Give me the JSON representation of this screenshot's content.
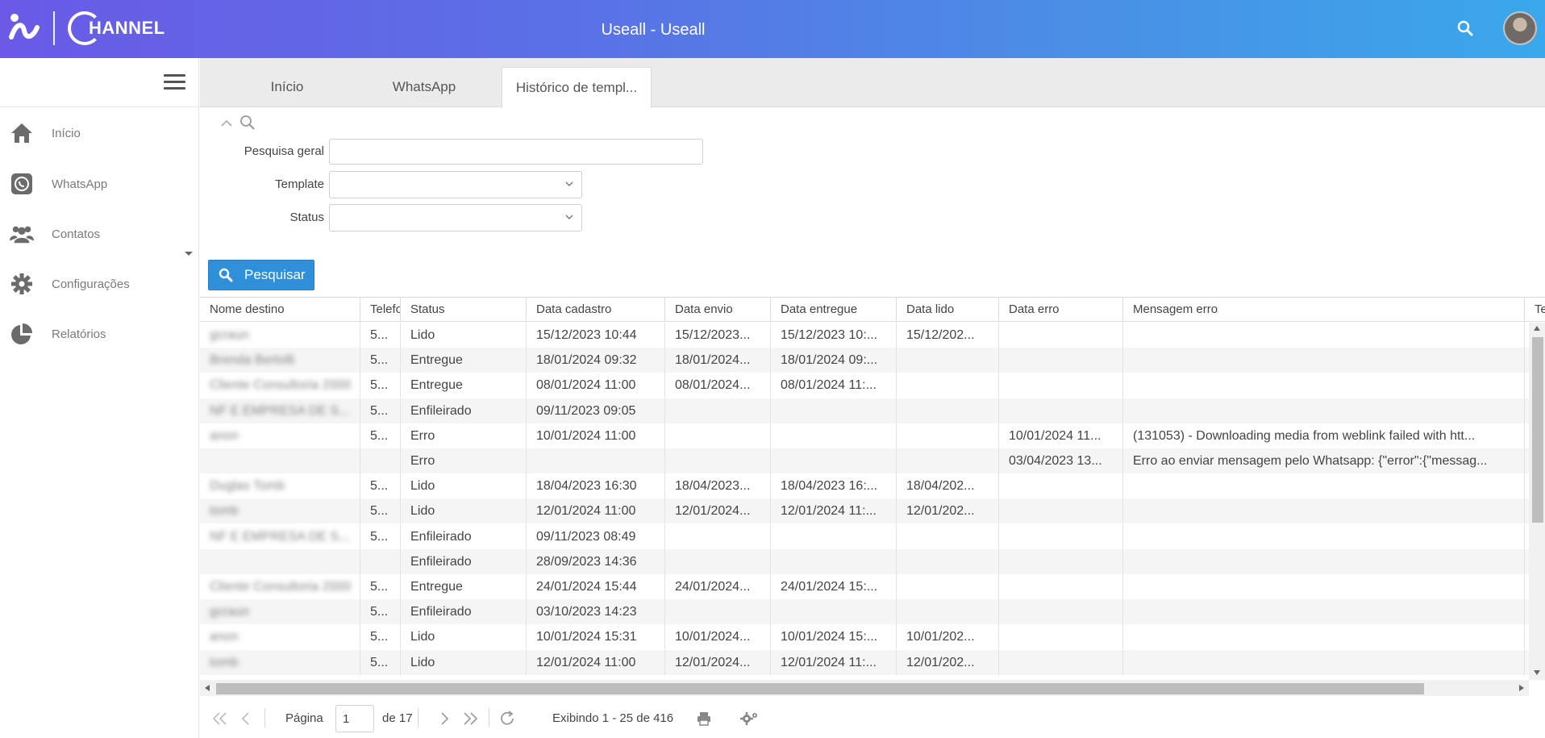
{
  "header": {
    "app_title": "Useall - Useall",
    "logo_text": "HANNEL"
  },
  "sidebar": {
    "items": [
      {
        "label": "Início",
        "icon": "home-icon"
      },
      {
        "label": "WhatsApp",
        "icon": "whatsapp-icon"
      },
      {
        "label": "Contatos",
        "icon": "contacts-icon"
      },
      {
        "label": "Configurações",
        "icon": "gear-icon"
      },
      {
        "label": "Relatórios",
        "icon": "pie-chart-icon"
      }
    ]
  },
  "tabs": [
    {
      "label": "Início",
      "active": false
    },
    {
      "label": "WhatsApp",
      "active": false
    },
    {
      "label": "Histórico de templ...",
      "active": true
    }
  ],
  "filter": {
    "general_search_label": "Pesquisa geral",
    "general_search_value": "",
    "template_label": "Template",
    "template_value": "",
    "status_label": "Status",
    "status_value": "",
    "search_button": "Pesquisar"
  },
  "grid": {
    "columns": [
      "Nome destino",
      "Telefo",
      "Status",
      "Data cadastro",
      "Data envio",
      "Data entregue",
      "Data lido",
      "Data erro",
      "Mensagem erro",
      "Te"
    ],
    "rows": [
      [
        "gcraun",
        "5...",
        "Lido",
        "15/12/2023 10:44",
        "15/12/2023...",
        "15/12/2023 10:...",
        "15/12/202...",
        "",
        ""
      ],
      [
        "Brenda Bertolli",
        "5...",
        "Entregue",
        "18/01/2024 09:32",
        "18/01/2024...",
        "18/01/2024 09:...",
        "",
        "",
        ""
      ],
      [
        "Cliente Consultoria 2000",
        "5...",
        "Entregue",
        "08/01/2024 11:00",
        "08/01/2024...",
        "08/01/2024 11:...",
        "",
        "",
        ""
      ],
      [
        "NF E EMPRESA DE S...",
        "5...",
        "Enfileirado",
        "09/11/2023 09:05",
        "",
        "",
        "",
        "",
        ""
      ],
      [
        "anon",
        "5...",
        "Erro",
        "10/01/2024 11:00",
        "",
        "",
        "",
        "10/01/2024 11...",
        "(131053) - Downloading media from weblink failed with htt..."
      ],
      [
        "",
        "",
        "Erro",
        "",
        "",
        "",
        "",
        "03/04/2023 13...",
        "Erro ao enviar mensagem pelo Whatsapp: {\"error\":{\"messag..."
      ],
      [
        "Duglas Tomb",
        "5...",
        "Lido",
        "18/04/2023 16:30",
        "18/04/2023...",
        "18/04/2023 16:...",
        "18/04/202...",
        "",
        ""
      ],
      [
        "tomb",
        "5...",
        "Lido",
        "12/01/2024 11:00",
        "12/01/2024...",
        "12/01/2024 11:...",
        "12/01/202...",
        "",
        ""
      ],
      [
        "NF E EMPRESA DE S...",
        "5...",
        "Enfileirado",
        "09/11/2023 08:49",
        "",
        "",
        "",
        "",
        ""
      ],
      [
        "",
        "",
        "Enfileirado",
        "28/09/2023 14:36",
        "",
        "",
        "",
        "",
        ""
      ],
      [
        "Cliente Consultoria 2000",
        "5...",
        "Entregue",
        "24/01/2024 15:44",
        "24/01/2024...",
        "24/01/2024 15:...",
        "",
        "",
        ""
      ],
      [
        "gcraun",
        "5...",
        "Enfileirado",
        "03/10/2023 14:23",
        "",
        "",
        "",
        "",
        ""
      ],
      [
        "anon",
        "5...",
        "Lido",
        "10/01/2024 15:31",
        "10/01/2024...",
        "10/01/2024 15:...",
        "10/01/202...",
        "",
        ""
      ],
      [
        "tomb",
        "5...",
        "Lido",
        "12/01/2024 11:00",
        "12/01/2024...",
        "12/01/2024 11:...",
        "12/01/202...",
        "",
        ""
      ]
    ]
  },
  "pager": {
    "page_label": "Página",
    "page_value": "1",
    "of_label": "de 17",
    "summary": "Exibindo 1 - 25 de 416"
  },
  "colors": {
    "header_gradient_start": "#6a5ae6",
    "header_gradient_end": "#3aa8ea",
    "primary_button": "#2f8fd8"
  }
}
